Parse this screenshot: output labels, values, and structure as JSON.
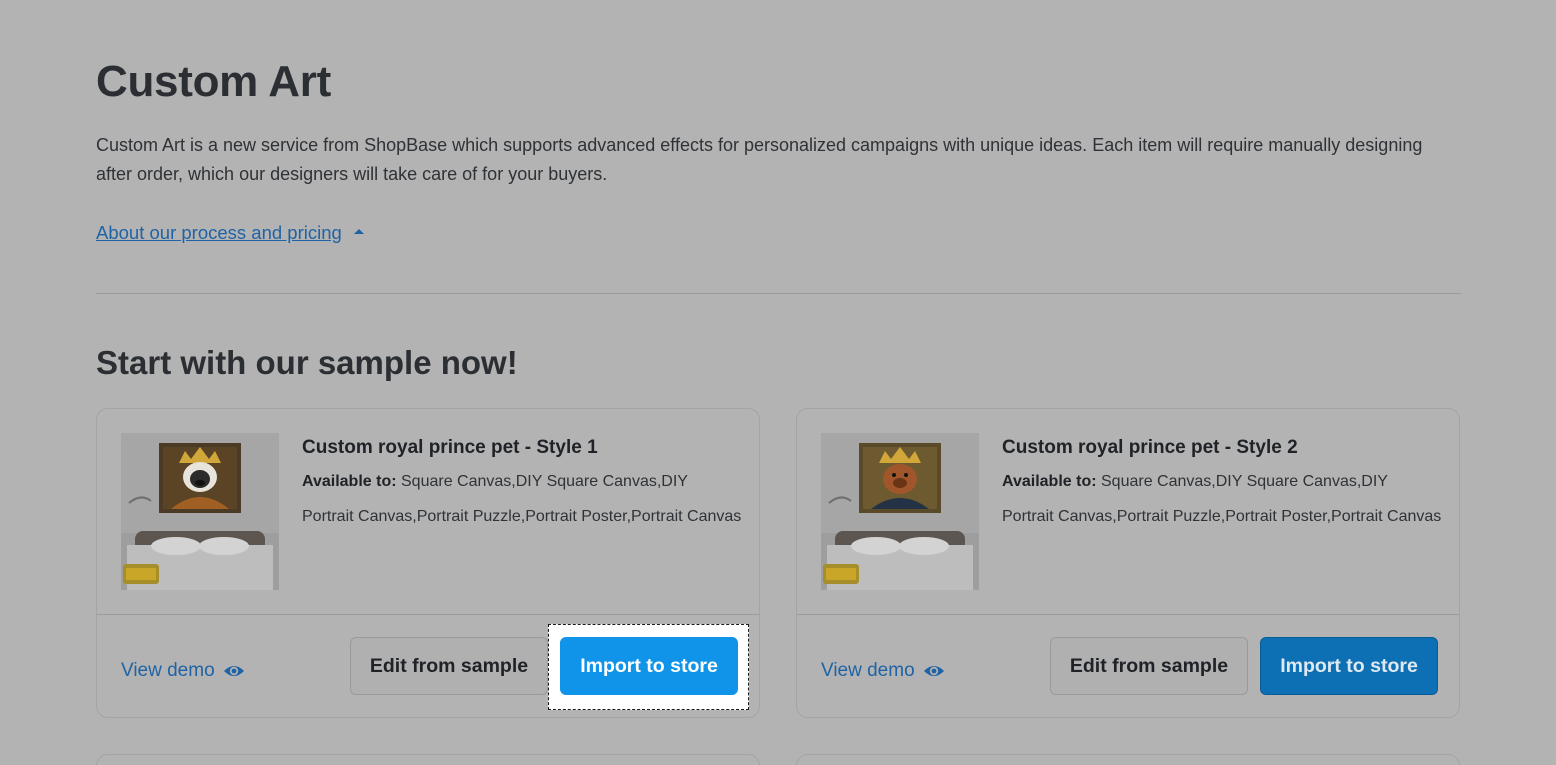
{
  "header": {
    "title": "Custom Art",
    "description": "Custom Art is a new service from ShopBase which supports advanced effects for personalized campaigns with unique ideas. Each item will require manually designing after order, which our designers will take care of for your buyers.",
    "process_link": "About our process and pricing"
  },
  "section": {
    "title": "Start with our sample now!"
  },
  "cards": [
    {
      "title": "Custom royal prince pet - Style 1",
      "available_label": "Available to:",
      "available_value": "Square Canvas,DIY Square Canvas,DIY Portrait Canvas,Portrait Puzzle,Portrait Poster,Portrait Canvas",
      "view_demo": "View demo",
      "edit_label": "Edit from sample",
      "import_label": "Import to store"
    },
    {
      "title": "Custom royal prince pet - Style 2",
      "available_label": "Available to:",
      "available_value": "Square Canvas,DIY Square Canvas,DIY Portrait Canvas,Portrait Puzzle,Portrait Poster,Portrait Canvas",
      "view_demo": "View demo",
      "edit_label": "Edit from sample",
      "import_label": "Import to store"
    }
  ],
  "colors": {
    "overlay_bg": "#b3b3b3",
    "link": "#1f63a6",
    "primary_button": "#0d6fb4",
    "primary_button_focused": "#0f94ea"
  },
  "icons": {
    "view_demo": "eye-icon",
    "process_toggle": "caret-up-icon"
  }
}
